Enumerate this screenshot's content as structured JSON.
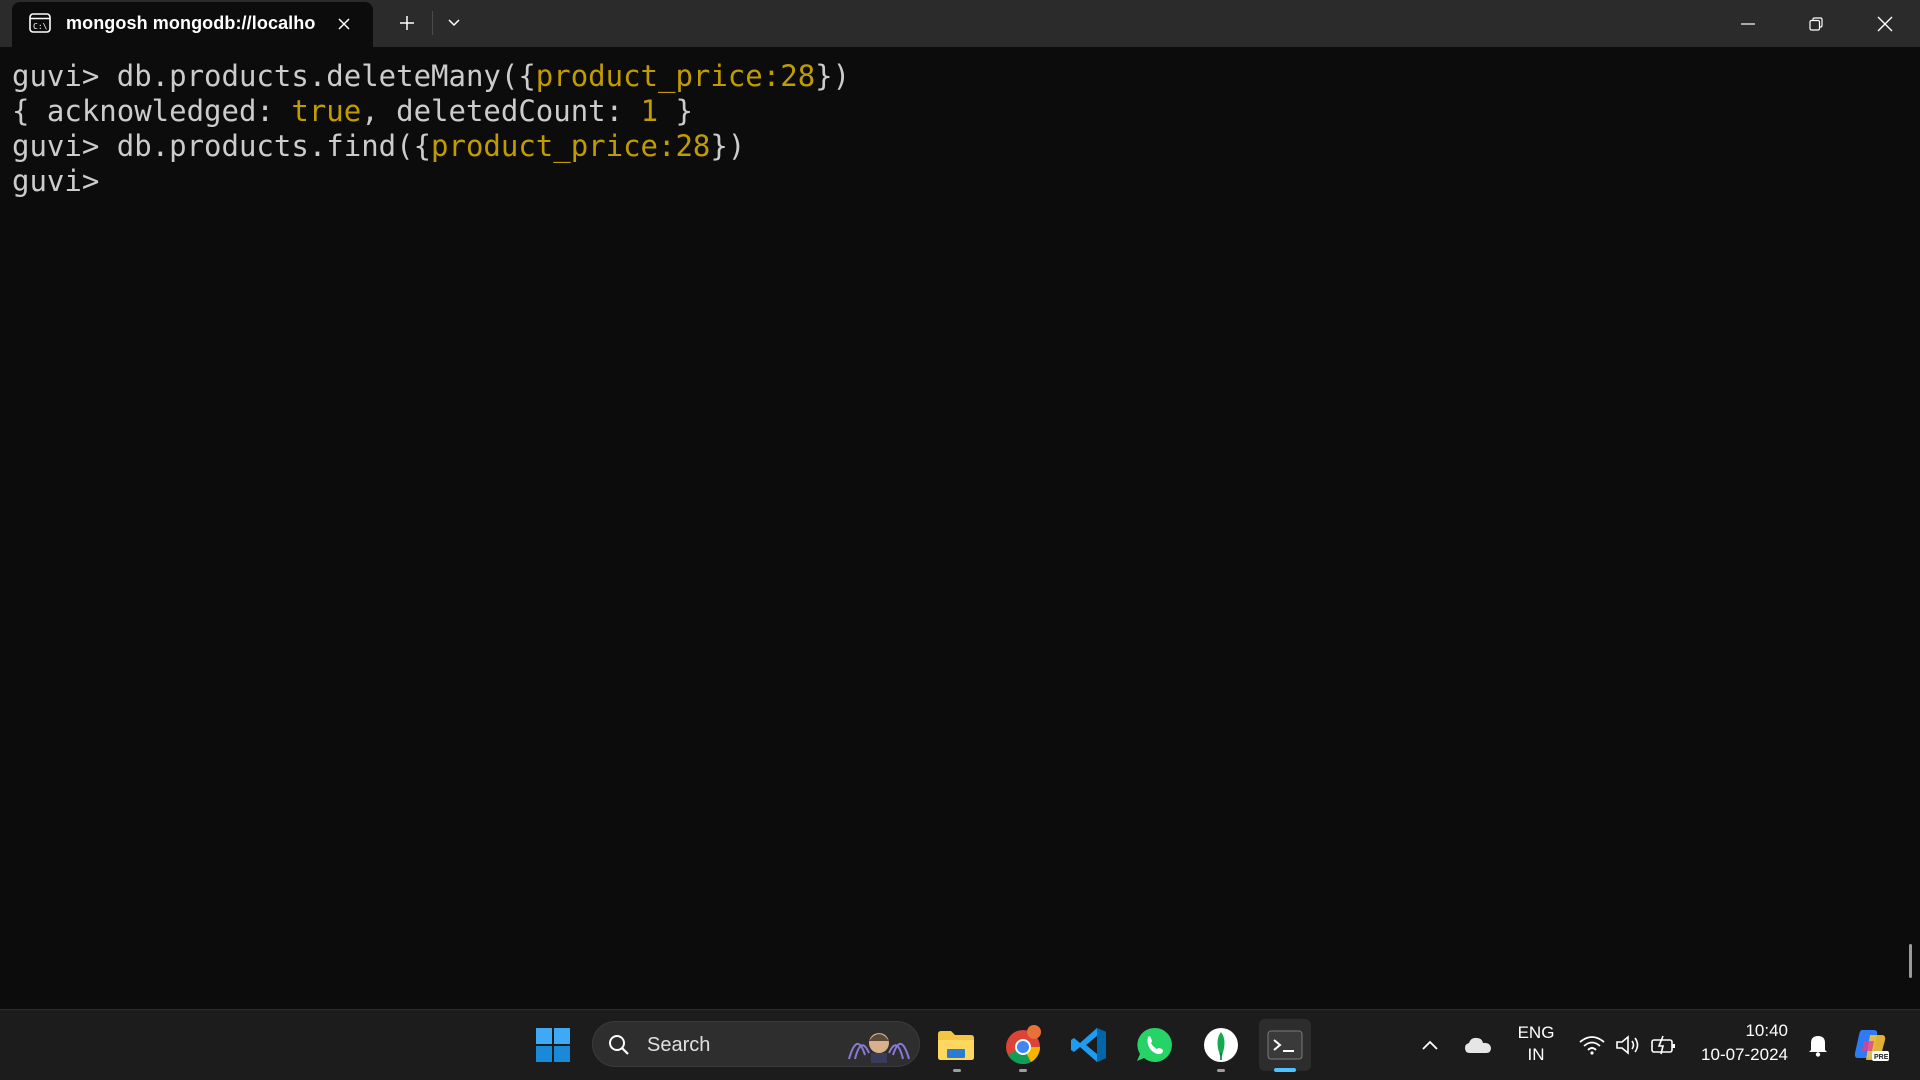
{
  "window": {
    "tab_title": "mongosh mongodb://localho"
  },
  "terminal": {
    "lines": [
      {
        "segments": [
          "guvi> db.products.deleteMany({",
          "product_price:28",
          "})"
        ]
      },
      {
        "segments": [
          "{ acknowledged: ",
          "true",
          ", deletedCount: ",
          "1",
          " }"
        ]
      },
      {
        "segments": [
          "guvi> db.products.find({",
          "product_price:28",
          "})"
        ]
      },
      {
        "segments": [
          "guvi> "
        ]
      }
    ],
    "colors": {
      "foreground": "#cccccc",
      "highlight": "#c19c00",
      "background": "#0c0c0c"
    }
  },
  "taskbar": {
    "search_placeholder": "Search",
    "apps": [
      "windows-start-icon",
      "file-explorer-icon",
      "chrome-icon",
      "vscode-icon",
      "whatsapp-icon",
      "mongodb-compass-icon",
      "terminal-icon"
    ],
    "language_line1": "ENG",
    "language_line2": "IN",
    "time": "10:40",
    "date": "10-07-2024",
    "accent": "#4cc2ff"
  }
}
